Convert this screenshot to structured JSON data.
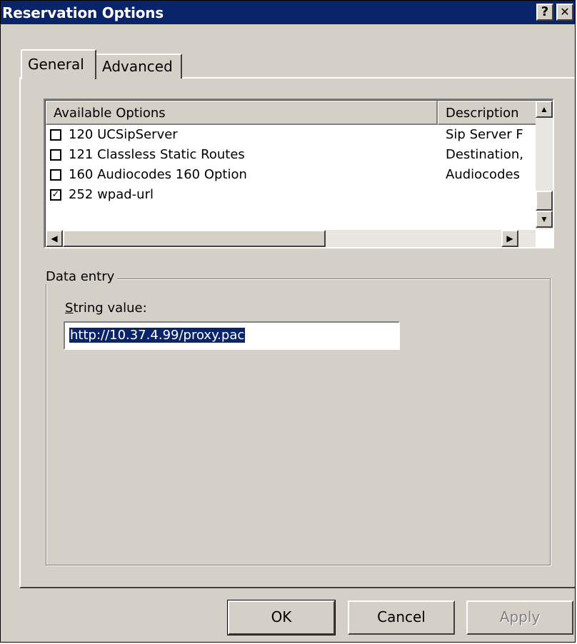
{
  "window": {
    "title": "Reservation Options",
    "help_glyph": "?",
    "close_glyph": "✕"
  },
  "tabs": [
    {
      "label": "General",
      "active": true
    },
    {
      "label": "Advanced",
      "active": false
    }
  ],
  "list": {
    "columns": [
      "Available Options",
      "Description"
    ],
    "rows": [
      {
        "checked": false,
        "name": "120 UCSipServer",
        "description": "Sip Server F"
      },
      {
        "checked": false,
        "name": "121 Classless Static Routes",
        "description": "Destination,"
      },
      {
        "checked": false,
        "name": "160 Audiocodes 160 Option",
        "description": "Audiocodes"
      },
      {
        "checked": true,
        "name": "252 wpad-url",
        "description": ""
      }
    ]
  },
  "data_entry": {
    "legend": "Data entry",
    "field_label_accel": "S",
    "field_label_rest": "tring value:",
    "value": "http://10.37.4.99/proxy.pac"
  },
  "buttons": {
    "ok": "OK",
    "cancel": "Cancel",
    "apply": "Apply"
  },
  "icons": {
    "checked": "✓",
    "scroll_up": "▲",
    "scroll_down": "▼",
    "scroll_left": "◀",
    "scroll_right": "▶"
  }
}
